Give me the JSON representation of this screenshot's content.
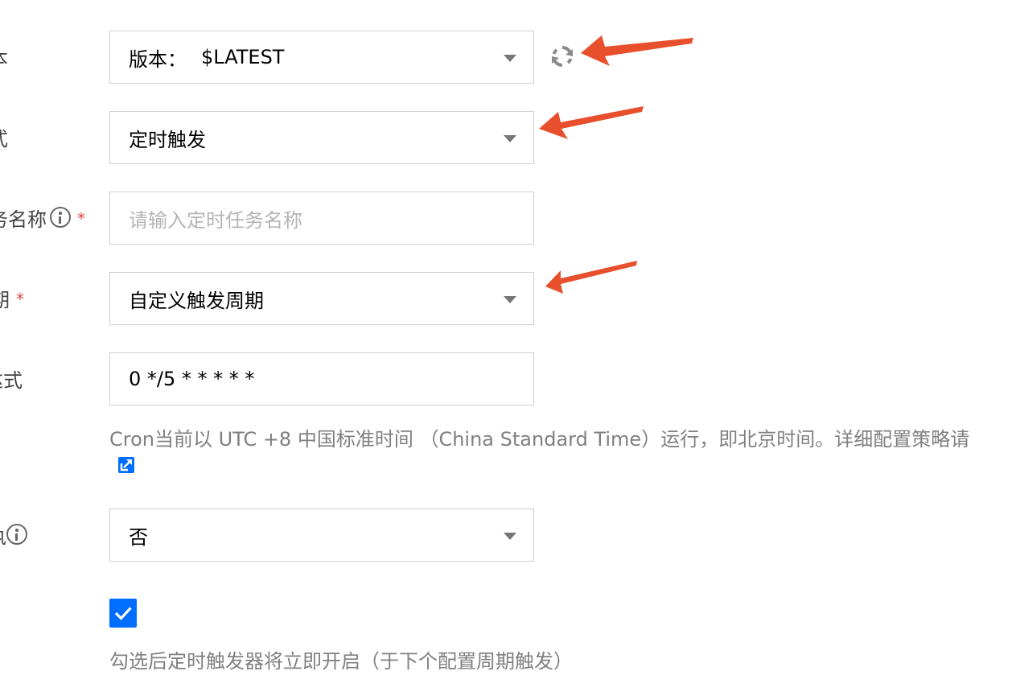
{
  "form": {
    "version": {
      "label_fragment": "本",
      "prefix": "版本：",
      "value": "$LATEST"
    },
    "trigger_method": {
      "label_fragment": "式",
      "value": "定时触发"
    },
    "task_name": {
      "label_fragment": "务名称",
      "required_mark": "*",
      "placeholder": "请输入定时任务名称",
      "value": ""
    },
    "trigger_period": {
      "label_fragment": "期",
      "required_mark": "*",
      "value": "自定义触发周期"
    },
    "cron_expression": {
      "label_fragment": "达式",
      "value": "0 */5 * * * * *"
    },
    "cron_hint": "Cron当前以 UTC +8 中国标准时间 （China Standard Time）运行，即北京时间。详细配置策略请",
    "async_option": {
      "label_fragment": "执",
      "value": "否"
    },
    "enable_checked": true,
    "enable_hint": "勾选后定时触发器将立即开启（于下个配置周期触发）"
  },
  "colors": {
    "accent": "#006eff",
    "annotation_arrow": "#e8502d",
    "required": "#e54545"
  },
  "icons": {
    "refresh": "refresh-icon",
    "info": "info-icon",
    "external_link": "external-link-icon",
    "check": "check-icon",
    "dropdown": "chevron-down-icon"
  }
}
